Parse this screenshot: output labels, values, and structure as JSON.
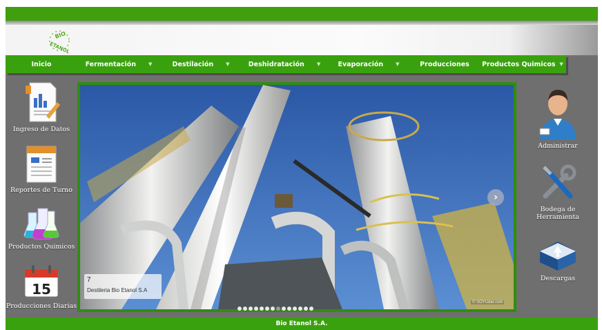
{
  "brand": {
    "logo_text_top": "BIO",
    "logo_text_bottom": "ETANOL"
  },
  "nav": {
    "items": [
      {
        "label": "Inicio",
        "has_dropdown": false
      },
      {
        "label": "Fermentación",
        "has_dropdown": true
      },
      {
        "label": "Destilación",
        "has_dropdown": true
      },
      {
        "label": "Deshidratación",
        "has_dropdown": true
      },
      {
        "label": "Evaporación",
        "has_dropdown": true
      },
      {
        "label": "Producciones",
        "has_dropdown": false
      },
      {
        "label": "Productos Quimicos",
        "has_dropdown": true
      }
    ]
  },
  "sidebar_left": {
    "items": [
      {
        "label": "Ingreso de Datos",
        "icon": "chart-report-icon"
      },
      {
        "label": "Reportes de Turno",
        "icon": "report-sheet-icon"
      },
      {
        "label": "Productos Quimicos",
        "icon": "chemistry-flasks-icon"
      },
      {
        "label": "Producciones Diarias",
        "icon": "calendar-icon",
        "calendar_day": "15"
      }
    ]
  },
  "sidebar_right": {
    "items": [
      {
        "label": "Administrar",
        "icon": "user-admin-icon"
      },
      {
        "label_line1": "Bodega de",
        "label_line2": "Herramienta",
        "icon": "tools-icon"
      },
      {
        "label": "Descargas",
        "icon": "download-box-icon"
      }
    ]
  },
  "slider": {
    "caption_number": "7",
    "caption_text": "Destileria Bio Etanol S.A",
    "watermark": "© SOYUdar.com",
    "next_symbol": "›",
    "slide_count": 14,
    "active_index": 7
  },
  "footer": {
    "text": "Bio Etanol S.A."
  },
  "colors": {
    "brand_green": "#3aa10e",
    "background_gray": "#6f6f6f",
    "sky_blue": "#3560a8"
  }
}
